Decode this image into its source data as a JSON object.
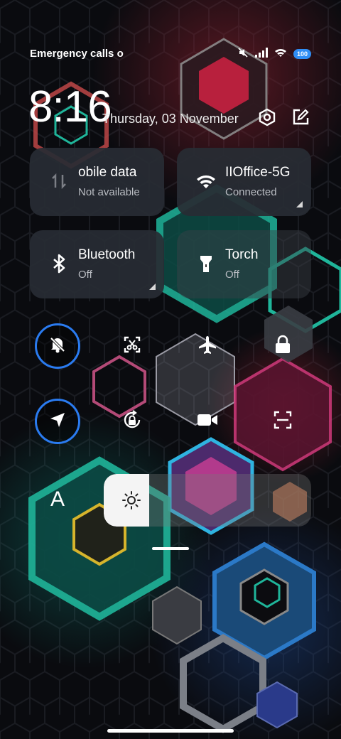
{
  "status_bar": {
    "carrier_text": "Emergency calls o",
    "battery_level": "100",
    "icons": [
      "mute-icon",
      "signal-icon",
      "wifi-icon",
      "battery-icon"
    ]
  },
  "header": {
    "time": "8:16",
    "date": "Thursday, 03 November",
    "icons": [
      "settings-icon",
      "edit-icon"
    ]
  },
  "tiles": [
    {
      "name": "obile data",
      "status": "Not available",
      "icon": "mobile-data-icon",
      "active": false
    },
    {
      "name": "IIOffice-5G",
      "status": "Connected",
      "icon": "wifi-icon",
      "active": true
    },
    {
      "name": "Bluetooth",
      "status": "Off",
      "icon": "bluetooth-icon",
      "active": false
    },
    {
      "name": "Torch",
      "status": "Off",
      "icon": "torch-icon",
      "active": false
    }
  ],
  "toggles": [
    {
      "icon": "silent-icon",
      "active": true
    },
    {
      "icon": "screenshot-icon",
      "active": false
    },
    {
      "icon": "airplane-icon",
      "active": false
    },
    {
      "icon": "lock-icon",
      "active": false
    },
    {
      "icon": "location-icon",
      "active": true
    },
    {
      "icon": "rotation-lock-icon",
      "active": false
    },
    {
      "icon": "screen-record-icon",
      "active": false
    },
    {
      "icon": "scanner-icon",
      "active": false
    }
  ],
  "brightness": {
    "auto_label": "A",
    "level_fraction": 0.22,
    "icon": "sun-icon"
  },
  "colors": {
    "accent_blue": "#2a7bf0",
    "tile_bg": "#282c34",
    "hex_teal": "#1fb59a",
    "hex_red": "#c0344e",
    "hex_blue": "#2b79c7"
  }
}
